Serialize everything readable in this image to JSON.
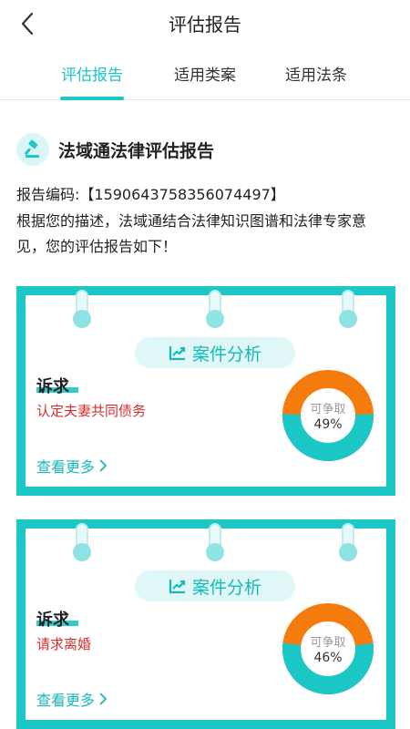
{
  "header": {
    "title": "评估报告"
  },
  "tabs": [
    {
      "label": "评估报告",
      "active": true
    },
    {
      "label": "适用类案",
      "active": false
    },
    {
      "label": "适用法条",
      "active": false
    }
  ],
  "report": {
    "title": "法域通法律评估报告",
    "code_line": "报告编码:【1590643758356074497】",
    "description": "根据您的描述，法域通结合法律知识图谱和法律专家意见，您的评估报告如下！"
  },
  "cards": [
    {
      "section_label": "案件分析",
      "claim_title": "诉求",
      "claim_text": "认定夫妻共同债务",
      "donut_label": "可争取",
      "donut_value": "49%",
      "percent": 49,
      "more_label": "查看更多"
    },
    {
      "section_label": "案件分析",
      "claim_title": "诉求",
      "claim_text": "请求离婚",
      "donut_label": "可争取",
      "donut_value": "46%",
      "percent": 46,
      "more_label": "查看更多"
    }
  ],
  "colors": {
    "accent": "#1bc7c7",
    "orange": "#f57c0c",
    "claim_red": "#d32f2f"
  }
}
